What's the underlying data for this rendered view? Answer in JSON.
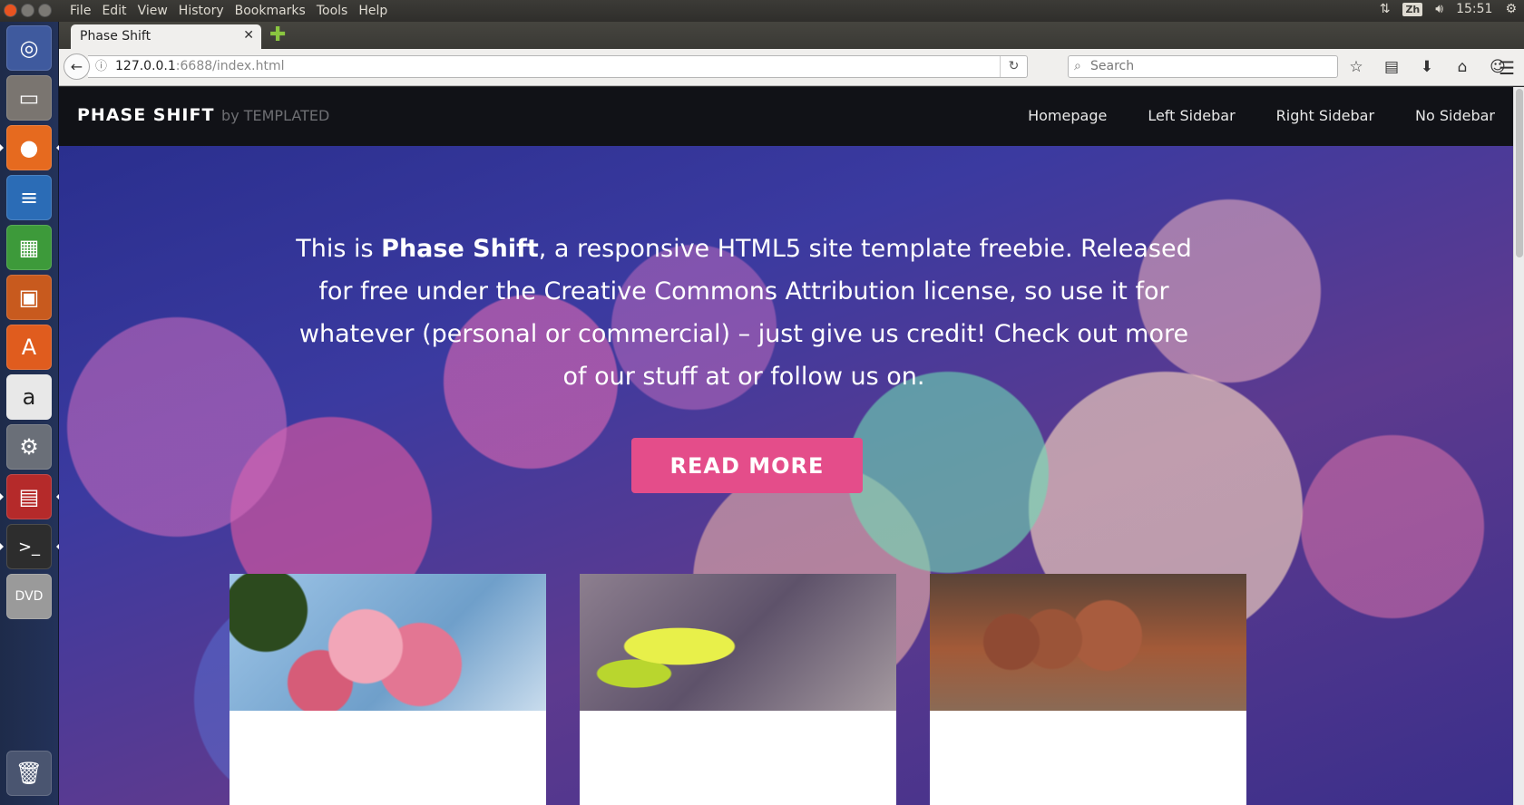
{
  "system": {
    "menus": [
      "File",
      "Edit",
      "View",
      "History",
      "Bookmarks",
      "Tools",
      "Help"
    ],
    "input_method": "Zh",
    "time": "15:51"
  },
  "browser": {
    "tab_title": "Phase Shift",
    "url_host": "127.0.0.1",
    "url_rest": ":6688/index.html",
    "search_placeholder": "Search"
  },
  "site": {
    "brand": "PHASE SHIFT",
    "brand_by": "by TEMPLATED",
    "nav": [
      "Homepage",
      "Left Sidebar",
      "Right Sidebar",
      "No Sidebar"
    ],
    "hero_prefix": "This is ",
    "hero_bold": "Phase Shift",
    "hero_suffix": ", a responsive HTML5 site template freebie. Released for free under the Creative Commons Attribution license, so use it for whatever (personal or commercial) – just give us credit! Check out more of our stuff at or follow us on.",
    "cta": "READ MORE"
  },
  "colors": {
    "accent": "#e44d8a",
    "header_bg": "#111217"
  }
}
